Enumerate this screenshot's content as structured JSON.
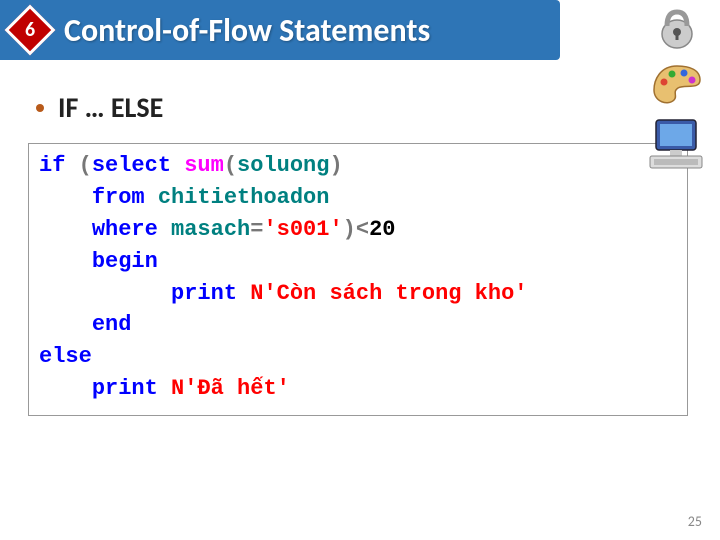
{
  "header": {
    "badge_number": "6",
    "title": "Control-of-Flow Statements"
  },
  "bullet": {
    "text": "IF … ELSE"
  },
  "code": {
    "l1_if": "if",
    "l1_paren": " (",
    "l1_select": "select ",
    "l1_sum": "sum",
    "l1_open": "(",
    "l1_arg": "soluong",
    "l1_close": ")",
    "l2_from": "from ",
    "l2_tbl": "chitiethoadon",
    "l3_where": "where ",
    "l3_col": "masach",
    "l3_eq": "=",
    "l3_str": "'s001'",
    "l3_close": ")<",
    "l3_num": "20",
    "l4_begin": "begin",
    "l5_print": "print ",
    "l5_str": "N'Còn sách trong kho'",
    "l6_end": "end",
    "l7_else": "else",
    "l8_print": "print ",
    "l8_str": "N'Đã hết'"
  },
  "page_number": "25",
  "icons": {
    "lock": "lock-icon",
    "palette": "palette-icon",
    "computer": "computer-icon"
  }
}
